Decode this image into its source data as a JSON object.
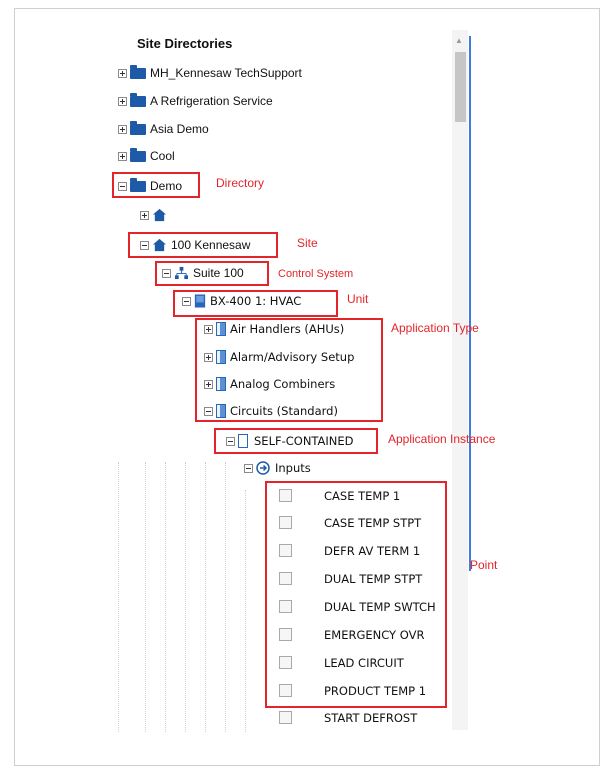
{
  "header": {
    "title": "Site Directories"
  },
  "directories": [
    {
      "label": "MH_Kennesaw TechSupport",
      "expanded": false
    },
    {
      "label": "A Refrigeration Service",
      "expanded": false
    },
    {
      "label": "Asia Demo",
      "expanded": false
    },
    {
      "label": "Cool",
      "expanded": false
    },
    {
      "label": "Demo",
      "expanded": true
    }
  ],
  "site": {
    "label": "100 Kennesaw"
  },
  "control_system": {
    "label": "Suite 100"
  },
  "unit": {
    "label": "BX-400 1: HVAC"
  },
  "application_types": [
    {
      "label": "Air Handlers (AHUs)"
    },
    {
      "label": "Alarm/Advisory Setup"
    },
    {
      "label": "Analog Combiners"
    },
    {
      "label": "Circuits (Standard)"
    }
  ],
  "application_instance": {
    "label": "SELF-CONTAINED"
  },
  "inputs": {
    "label": "Inputs"
  },
  "points": [
    {
      "label": "CASE TEMP 1"
    },
    {
      "label": "CASE TEMP STPT"
    },
    {
      "label": "DEFR AV TERM 1"
    },
    {
      "label": "DUAL TEMP STPT"
    },
    {
      "label": "DUAL TEMP SWTCH"
    },
    {
      "label": "EMERGENCY OVR"
    },
    {
      "label": "LEAD CIRCUIT"
    },
    {
      "label": "PRODUCT TEMP 1"
    },
    {
      "label": "START DEFROST"
    }
  ],
  "annotations": {
    "directory": "Directory",
    "site": "Site",
    "control_system": "Control System",
    "unit": "Unit",
    "application_type": "Application Type",
    "application_instance": "Application Instance",
    "point": "Point"
  },
  "colors": {
    "annotation": "#e3252b",
    "icon": "#1f5aa8",
    "scroll_accent": "#3f7be0"
  }
}
